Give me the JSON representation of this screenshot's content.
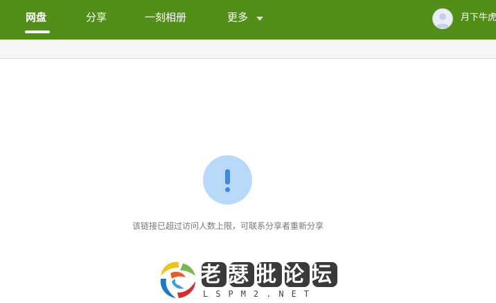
{
  "nav": {
    "items": [
      {
        "label": "网盘",
        "active": true
      },
      {
        "label": "分享",
        "active": false
      },
      {
        "label": "一刻相册",
        "active": false
      },
      {
        "label": "更多",
        "active": false
      }
    ]
  },
  "user": {
    "name": "月下牛虎"
  },
  "notice": {
    "message": "该链接已超过访问人数上限，可联系分享者重新分享"
  },
  "watermark": {
    "title": "老瑟批论坛",
    "url": "LSPM2.NET"
  },
  "colors": {
    "header_bg": "#528f19",
    "alert_circle": "#b9d9fb",
    "alert_icon": "#3d89e6",
    "message_text": "#777777"
  },
  "icons": {
    "alert": "exclamation-icon",
    "more": "caret-down-icon",
    "avatar": "user-avatar-icon"
  }
}
